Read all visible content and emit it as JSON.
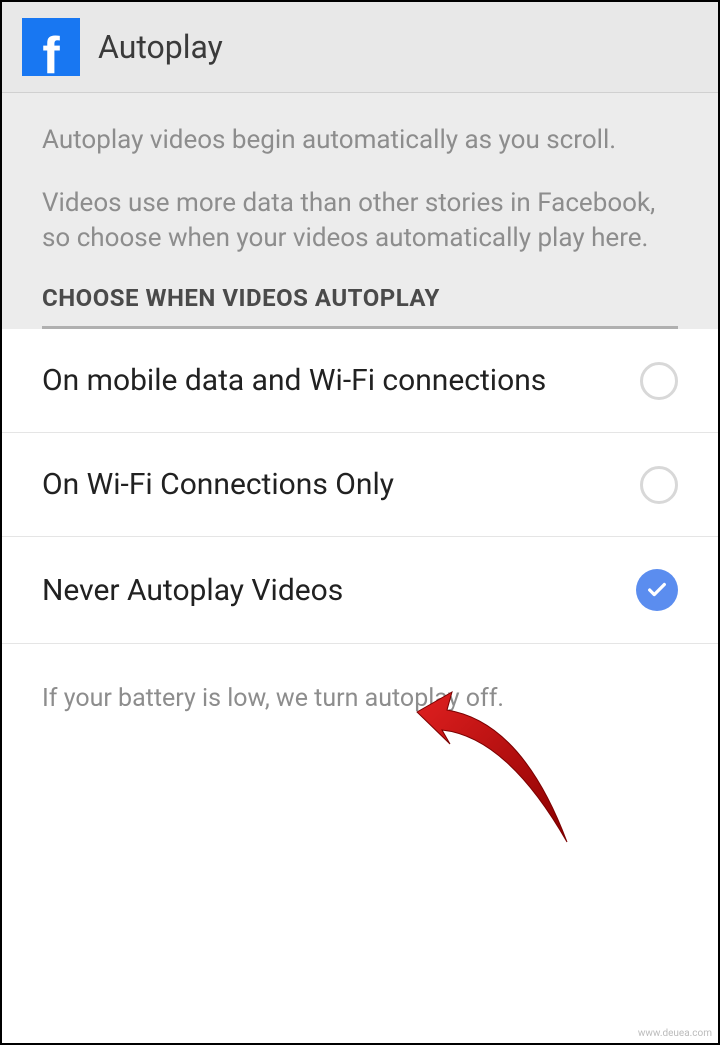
{
  "header": {
    "title": "Autoplay"
  },
  "description": {
    "para1": "Autoplay videos begin automatically as you scroll.",
    "para2": "Videos use more data than other stories in Facebook, so choose when your videos automatically play here."
  },
  "section": {
    "title": "CHOOSE WHEN VIDEOS AUTOPLAY"
  },
  "options": [
    {
      "label": "On mobile data and Wi-Fi connections",
      "selected": false
    },
    {
      "label": "On Wi-Fi Connections Only",
      "selected": false
    },
    {
      "label": "Never Autoplay Videos",
      "selected": true
    }
  ],
  "footer": {
    "note": "If your battery is low, we turn autoplay off."
  },
  "watermark": "www.deuea.com"
}
